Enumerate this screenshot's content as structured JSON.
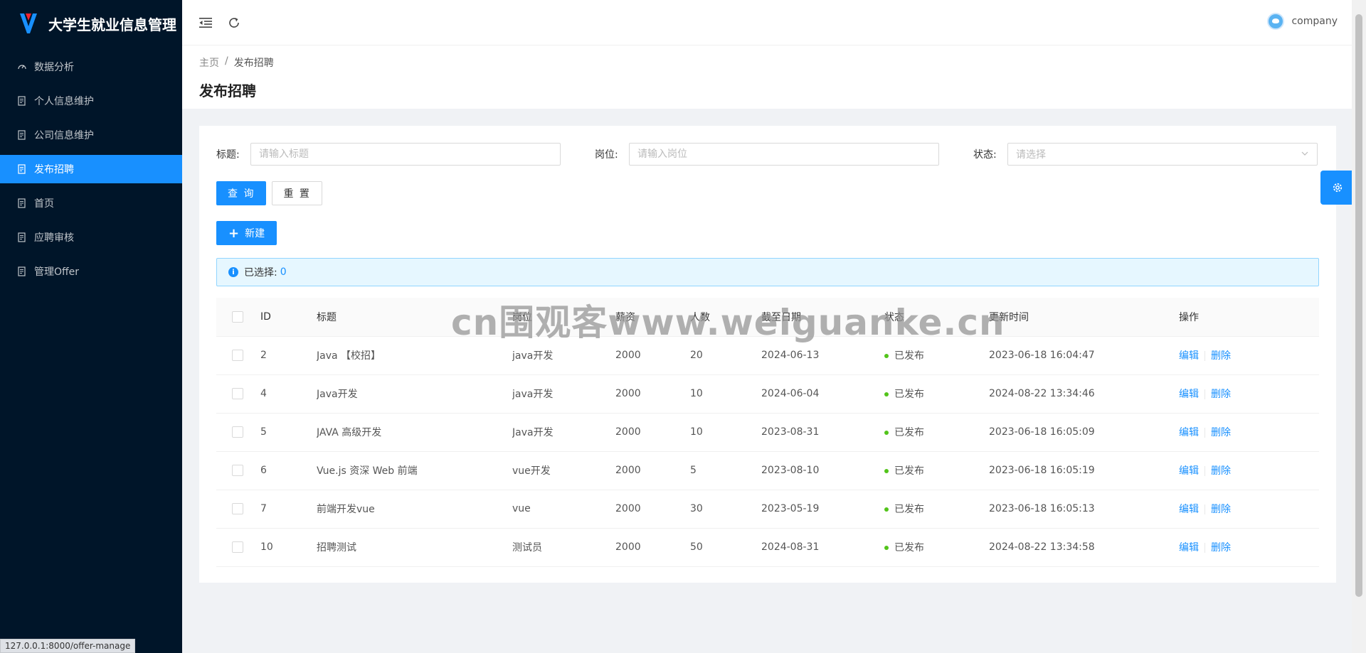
{
  "app": {
    "title": "大学生就业信息管理"
  },
  "sidebar": {
    "items": [
      {
        "label": "数据分析",
        "icon": "dashboard-icon",
        "active": false
      },
      {
        "label": "个人信息维护",
        "icon": "file-icon",
        "active": false
      },
      {
        "label": "公司信息维护",
        "icon": "file-icon",
        "active": false
      },
      {
        "label": "发布招聘",
        "icon": "file-icon",
        "active": true
      },
      {
        "label": "首页",
        "icon": "file-icon",
        "active": false
      },
      {
        "label": "应聘审核",
        "icon": "file-icon",
        "active": false
      },
      {
        "label": "管理Offer",
        "icon": "file-icon",
        "active": false
      }
    ]
  },
  "header": {
    "username": "company"
  },
  "breadcrumb": {
    "home": "主页",
    "sep": "/",
    "current": "发布招聘"
  },
  "page": {
    "title": "发布招聘"
  },
  "filters": {
    "title_label": "标题:",
    "title_placeholder": "请输入标题",
    "position_label": "岗位:",
    "position_placeholder": "请输入岗位",
    "status_label": "状态:",
    "status_placeholder": "请选择"
  },
  "buttons": {
    "query": "查 询",
    "reset": "重 置",
    "new": "新建"
  },
  "alert": {
    "label": "已选择:",
    "count": "0"
  },
  "table": {
    "headers": [
      "ID",
      "标题",
      "岗位",
      "薪资",
      "人数",
      "截至日期",
      "状态",
      "更新时间",
      "操作"
    ],
    "rows": [
      {
        "id": "2",
        "title": "Java 【校招】",
        "position": "java开发",
        "salary": "2000",
        "count": "20",
        "deadline": "2024-06-13",
        "status": "已发布",
        "updated": "2023-06-18 16:04:47"
      },
      {
        "id": "4",
        "title": "Java开发",
        "position": "java开发",
        "salary": "2000",
        "count": "10",
        "deadline": "2024-06-04",
        "status": "已发布",
        "updated": "2024-08-22 13:34:46"
      },
      {
        "id": "5",
        "title": "JAVA 高级开发",
        "position": "Java开发",
        "salary": "2000",
        "count": "10",
        "deadline": "2023-08-31",
        "status": "已发布",
        "updated": "2023-06-18 16:05:09"
      },
      {
        "id": "6",
        "title": "Vue.js 资深 Web 前端",
        "position": "vue开发",
        "salary": "2000",
        "count": "5",
        "deadline": "2023-08-10",
        "status": "已发布",
        "updated": "2023-06-18 16:05:19"
      },
      {
        "id": "7",
        "title": "前端开发vue",
        "position": "vue",
        "salary": "2000",
        "count": "30",
        "deadline": "2023-05-19",
        "status": "已发布",
        "updated": "2023-06-18 16:05:13"
      },
      {
        "id": "10",
        "title": "招聘测试",
        "position": "测试员",
        "salary": "2000",
        "count": "50",
        "deadline": "2024-08-31",
        "status": "已发布",
        "updated": "2024-08-22 13:34:58"
      }
    ],
    "action_edit": "编辑",
    "action_delete": "删除"
  },
  "statusbar": {
    "url": "127.0.0.1:8000/offer-manage"
  },
  "watermark": "cn围观客www.weiguanke.cn",
  "colors": {
    "primary": "#1890ff",
    "sidebar_bg": "#001529",
    "success": "#52c41a"
  }
}
